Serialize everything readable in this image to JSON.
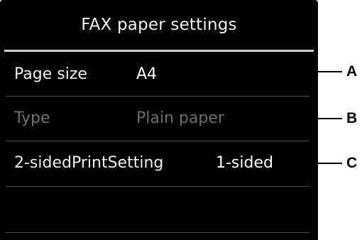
{
  "screen": {
    "title": "FAX paper settings",
    "rows": [
      {
        "label": "Page size",
        "value": "A4",
        "enabled": true
      },
      {
        "label": "Type",
        "value": "Plain paper",
        "enabled": false
      },
      {
        "label": "2-sidedPrintSetting",
        "value": "1-sided",
        "enabled": true
      }
    ]
  },
  "callouts": [
    "A",
    "B",
    "C"
  ],
  "colors": {
    "background": "#000000",
    "text": "#f0f0f0",
    "disabled_text": "#6e6e6e",
    "divider": "#4a4a4a"
  }
}
